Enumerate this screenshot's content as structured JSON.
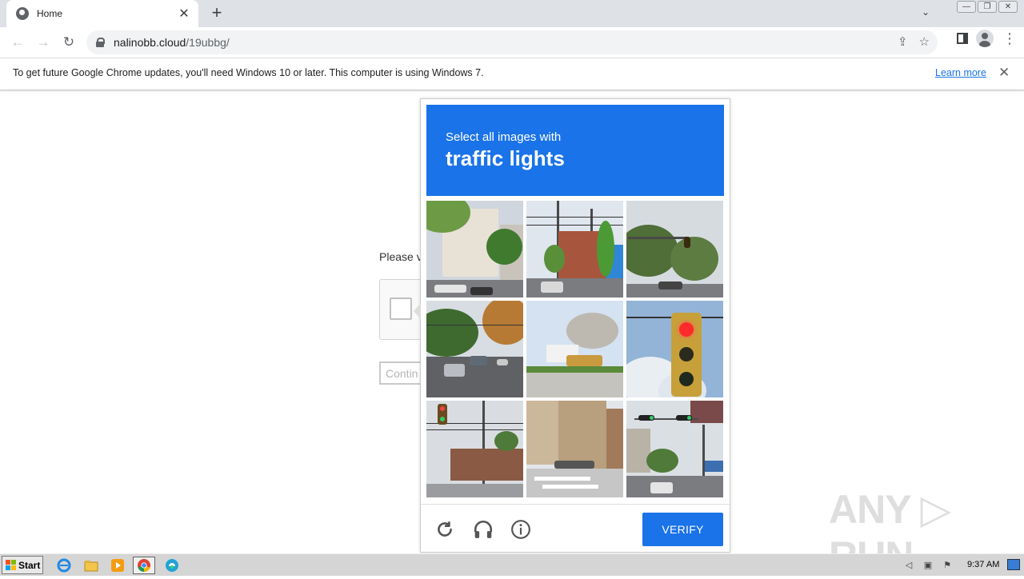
{
  "browser": {
    "tab": {
      "title": "Home",
      "close": "✕"
    },
    "new_tab": "+",
    "tab_search": "⌄",
    "window_buttons": {
      "minimize": "—",
      "restore": "❐",
      "close": "✕"
    },
    "nav": {
      "back": "←",
      "forward": "→",
      "reload": "↻"
    },
    "url": {
      "host": "nalinobb.cloud",
      "path": "/19ubbg/"
    },
    "omni_icons": {
      "share": "⇪",
      "bookmark": "☆"
    },
    "menu": "⋮"
  },
  "infobar": {
    "message": "To get future Google Chrome updates, you'll need Windows 10 or later. This computer is using Windows 7.",
    "link": "Learn more",
    "close": "✕"
  },
  "page": {
    "prompt_partial": "Please v",
    "continue_partial": "Contin"
  },
  "captcha": {
    "instruction": "Select all images with",
    "target": "traffic lights",
    "tiles": [
      {
        "row": 0,
        "col": 0,
        "scene": "street-trees-buildings"
      },
      {
        "row": 0,
        "col": 1,
        "scene": "street-utility-poles"
      },
      {
        "row": 0,
        "col": 2,
        "scene": "intersection-trees"
      },
      {
        "row": 1,
        "col": 0,
        "scene": "road-cars-autumn"
      },
      {
        "row": 1,
        "col": 1,
        "scene": "bus-parking-lot"
      },
      {
        "row": 1,
        "col": 2,
        "scene": "traffic-light-closeup"
      },
      {
        "row": 2,
        "col": 0,
        "scene": "street-poles-light"
      },
      {
        "row": 2,
        "col": 1,
        "scene": "crosswalk-buildings"
      },
      {
        "row": 2,
        "col": 2,
        "scene": "intersection-signals"
      }
    ],
    "footer": {
      "reload_icon": "↻",
      "audio_icon": "🎧",
      "info_icon": "ⓘ",
      "verify": "VERIFY"
    },
    "colors": {
      "header": "#1a73e8",
      "verify": "#1a73e8"
    }
  },
  "watermark": "ANY ▷ RUN",
  "taskbar": {
    "start": "Start",
    "apps": [
      "internet-explorer",
      "file-explorer",
      "media-player",
      "chrome",
      "edge"
    ],
    "clock": "9:37 AM"
  }
}
